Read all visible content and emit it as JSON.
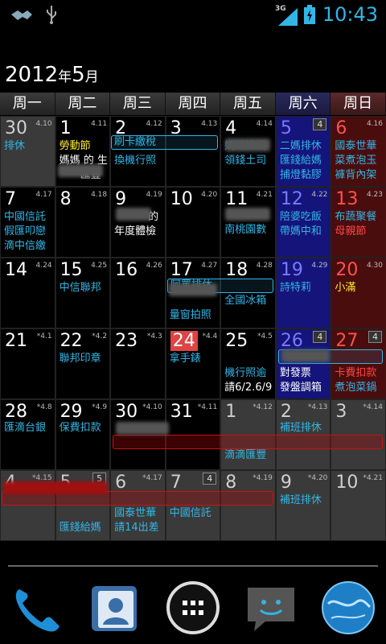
{
  "status_bar": {
    "time": "10:43",
    "network": "3G",
    "icons": [
      "handshake-icon",
      "usb-icon",
      "signal-icon",
      "battery-icon"
    ]
  },
  "header": {
    "year": "2012",
    "year_suffix": "年",
    "month": "5",
    "month_suffix": "月"
  },
  "weekdays": [
    "周一",
    "周二",
    "周三",
    "周四",
    "周五",
    "周六",
    "周日"
  ],
  "weeks": [
    [
      {
        "day": "30",
        "lunar": "4.10",
        "type": "other",
        "events": [
          "排休"
        ]
      },
      {
        "day": "1",
        "lunar": "4.11",
        "events": [
          "勞動節",
          "媽媽 的 生",
          "匯豐"
        ]
      },
      {
        "day": "2",
        "lunar": "4.12",
        "events": [
          "換機行照"
        ]
      },
      {
        "day": "3",
        "lunar": "4.13",
        "events": []
      },
      {
        "day": "4",
        "lunar": "4.14",
        "events": [
          "媽跟姨媽",
          "領錢土司"
        ]
      },
      {
        "day": "5",
        "lunar": "4",
        "events": [
          "二媽排休",
          "匯錢給媽",
          "捕燈黏膠"
        ]
      },
      {
        "day": "6",
        "lunar": "4.16",
        "events": [
          "國泰世華",
          "菜煮泡玉",
          "褲背內架"
        ]
      }
    ],
    [
      {
        "day": "7",
        "lunar": "4.17",
        "events": [
          "中國信託",
          "假匯叩戀",
          "滴中信繳"
        ]
      },
      {
        "day": "8",
        "lunar": "4.18",
        "events": []
      },
      {
        "day": "9",
        "lunar": "4.19",
        "events": [
          "的",
          "年度體檢"
        ]
      },
      {
        "day": "10",
        "lunar": "4.20",
        "events": []
      },
      {
        "day": "11",
        "lunar": "4.21",
        "events": [
          "南桃園數"
        ]
      },
      {
        "day": "12",
        "lunar": "4.22",
        "events": [
          "陪婆吃飯",
          "帶媽中和"
        ]
      },
      {
        "day": "13",
        "lunar": "4.23",
        "events": [
          "布蔬聚餐",
          "母親節"
        ]
      }
    ],
    [
      {
        "day": "14",
        "lunar": "4.24",
        "events": []
      },
      {
        "day": "15",
        "lunar": "4.25",
        "events": [
          "中信聯邦"
        ]
      },
      {
        "day": "16",
        "lunar": "4.26",
        "events": []
      },
      {
        "day": "17",
        "lunar": "4.27",
        "events": [
          "量窗拍照"
        ]
      },
      {
        "day": "18",
        "lunar": "4.28",
        "events": [
          "全國冰箱"
        ]
      },
      {
        "day": "19",
        "lunar": "4.29",
        "events": [
          "詩特莉"
        ]
      },
      {
        "day": "20",
        "lunar": "4.30",
        "events": [
          "小滿"
        ]
      }
    ],
    [
      {
        "day": "21",
        "lunar": "*4.1",
        "events": []
      },
      {
        "day": "22",
        "lunar": "*4.2",
        "events": [
          "聯邦印章"
        ]
      },
      {
        "day": "23",
        "lunar": "*4.3",
        "events": []
      },
      {
        "day": "24",
        "lunar": "*4.4",
        "events": [
          "拿手錶"
        ]
      },
      {
        "day": "25",
        "lunar": "*4.5",
        "events": [
          "機行照逾",
          "請6/2.6/9"
        ]
      },
      {
        "day": "26",
        "lunar": "4",
        "events": [
          "對發票",
          "發盤調箱"
        ]
      },
      {
        "day": "27",
        "lunar": "4",
        "events": [
          "卡費扣款",
          "煮泡菜鍋"
        ]
      }
    ],
    [
      {
        "day": "28",
        "lunar": "*4.8",
        "events": [
          "匯滴台銀"
        ]
      },
      {
        "day": "29",
        "lunar": "*4.9",
        "events": [
          "保費扣款"
        ]
      },
      {
        "day": "30",
        "lunar": "*4.10",
        "events": []
      },
      {
        "day": "31",
        "lunar": "*4.11",
        "events": []
      },
      {
        "day": "1",
        "lunar": "*4.12",
        "type": "other",
        "events": [
          "滴滴匯豐"
        ]
      },
      {
        "day": "2",
        "lunar": "*4.13",
        "type": "other",
        "events": [
          "補班排休"
        ]
      },
      {
        "day": "3",
        "lunar": "*4.14",
        "type": "other",
        "events": []
      }
    ],
    [
      {
        "day": "4",
        "lunar": "*4.15",
        "type": "other",
        "events": []
      },
      {
        "day": "5",
        "lunar": "5",
        "type": "other",
        "events": [
          "匯錢給媽"
        ]
      },
      {
        "day": "6",
        "lunar": "*4.17",
        "type": "other",
        "events": [
          "國泰世華",
          "請14出差"
        ]
      },
      {
        "day": "7",
        "lunar": "4",
        "type": "other",
        "events": [
          "中國信託"
        ]
      },
      {
        "day": "8",
        "lunar": "*4.19",
        "type": "other",
        "events": []
      },
      {
        "day": "9",
        "lunar": "*4.20",
        "type": "other",
        "events": [
          "補班排休"
        ]
      },
      {
        "day": "10",
        "lunar": "*4.21",
        "type": "other",
        "events": []
      }
    ]
  ],
  "bars": {
    "w1": "刷卡繳稅",
    "w3": "阿罵排休"
  },
  "dock": [
    "phone-icon",
    "contacts-icon",
    "apps-icon",
    "messaging-icon",
    "browser-icon"
  ]
}
